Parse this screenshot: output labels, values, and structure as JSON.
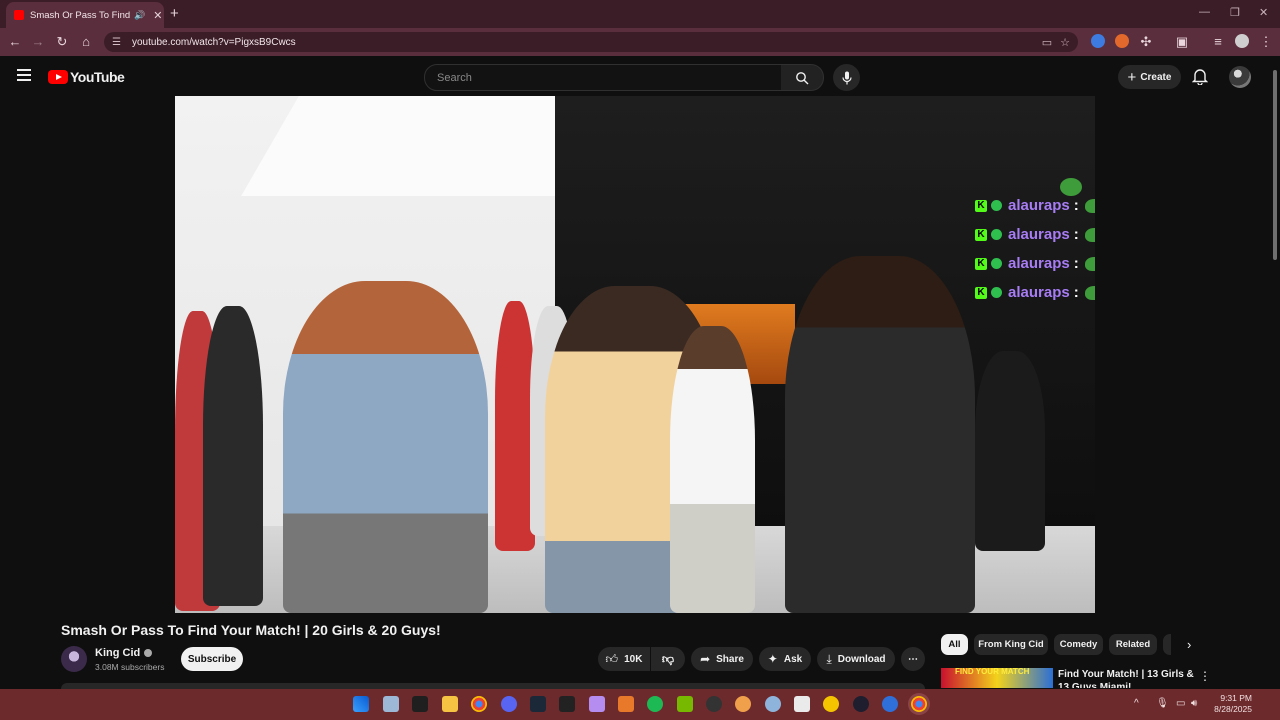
{
  "browser": {
    "tab_title": "Smash Or Pass To Find Your Match! | 20 Girls & 20 Guys!",
    "url": "youtube.com/watch?v=PigxsB9Cwcs",
    "new_tab": "+",
    "accent": "#5a2e3c"
  },
  "youtube": {
    "logo_text": "YouTube",
    "search_placeholder": "Search",
    "create_label": "Create"
  },
  "video": {
    "overlay_chat": [
      {
        "user": "alauraps",
        "sep": ":"
      },
      {
        "user": "alauraps",
        "sep": ":"
      },
      {
        "user": "alauraps",
        "sep": ":"
      },
      {
        "user": "alauraps",
        "sep": ":"
      }
    ]
  },
  "meta": {
    "title": "Smash Or Pass To Find Your Match! | 20 Girls & 20 Guys!",
    "channel": "King Cid",
    "subscribers": "3.08M subscribers",
    "subscribe_label": "Subscribe",
    "likes": "10K",
    "share_label": "Share",
    "ask_label": "Ask",
    "download_label": "Download"
  },
  "chips": [
    "All",
    "From King Cid",
    "Comedy",
    "Related"
  ],
  "recommended": {
    "title": "Find Your Match! | 13 Girls & 13 Guys Miami!",
    "thumb_text": "FIND YOUR MATCH"
  },
  "taskbar": {
    "time": "9:31 PM",
    "date": "8/28/2025"
  }
}
